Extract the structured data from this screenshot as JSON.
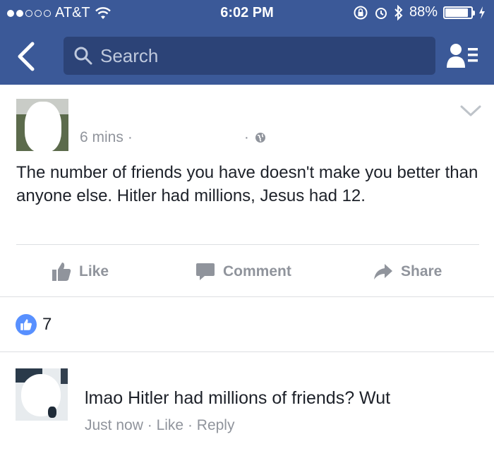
{
  "status_bar": {
    "carrier": "AT&T",
    "time": "6:02 PM",
    "battery": "88%",
    "battery_level": 0.88,
    "signal_bars_filled": 2,
    "signal_bars_total": 5
  },
  "nav": {
    "search_placeholder": "Search"
  },
  "post": {
    "time": "6 mins",
    "separator": "·",
    "text": "The number of friends you have doesn't make you better than anyone else. Hitler had millions, Jesus had 12."
  },
  "actions": {
    "like": "Like",
    "comment": "Comment",
    "share": "Share"
  },
  "reactions": {
    "count": "7"
  },
  "comment": {
    "text": "lmao Hitler had millions of friends? Wut",
    "time": "Just now",
    "like": "Like",
    "reply": "Reply",
    "separator": "·"
  },
  "colors": {
    "brand": "#3b5998",
    "search_bg": "#2c4377",
    "like_blue": "#5890ff",
    "muted_text": "#90949c"
  }
}
